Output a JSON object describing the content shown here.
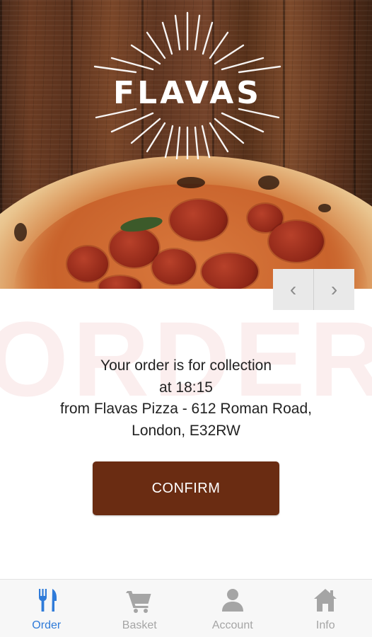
{
  "brand": {
    "name": "FLAVAS"
  },
  "hero": {
    "prev_label": "‹",
    "next_label": "›"
  },
  "watermark": "ORDER",
  "order_info": {
    "line1": "Your order is for collection",
    "line2": "at 18:15",
    "line3": "from Flavas Pizza - 612 Roman Road,",
    "line4": "London, E32RW"
  },
  "confirm_label": "CONFIRM",
  "tabs": [
    {
      "label": "Order",
      "icon": "fork-knife-icon",
      "active": true
    },
    {
      "label": "Basket",
      "icon": "cart-icon",
      "active": false
    },
    {
      "label": "Account",
      "icon": "person-icon",
      "active": false
    },
    {
      "label": "Info",
      "icon": "home-icon",
      "active": false
    }
  ],
  "colors": {
    "accent": "#2f7bd9",
    "button": "#6a2c12",
    "inactive": "#a5a5a5",
    "watermark": "#fbeeee"
  }
}
